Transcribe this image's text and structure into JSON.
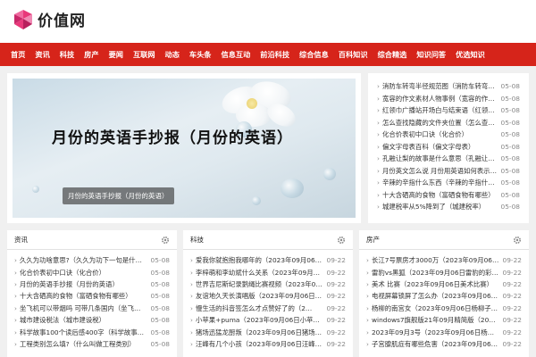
{
  "site": {
    "logo_text": "价值网"
  },
  "nav": [
    "首页",
    "资讯",
    "科技",
    "房产",
    "要闻",
    "互联网",
    "动态",
    "车头条",
    "信息互动",
    "前沿科技",
    "综合信息",
    "百科知识",
    "综合精选",
    "知识问答",
    "优选知识"
  ],
  "banner": {
    "title": "月份的英语手抄报（月份的英语）",
    "caption": "月份的英语手抄报（月份的英语）"
  },
  "top_list": [
    {
      "title": "消防车转弯半径规范图（消防车转弯半…",
      "date": "05-08"
    },
    {
      "title": "宽容的作文素材人物事例（宽容的作文）",
      "date": "05-08"
    },
    {
      "title": "红领巾广播站开场白与结束语（红领巾…",
      "date": "05-08"
    },
    {
      "title": "怎么查找隐藏的文件夹位置（怎么查找…",
      "date": "05-08"
    },
    {
      "title": "化合价表初中口诀（化合价）",
      "date": "05-08"
    },
    {
      "title": "偏文字母表百科（偏文字母表）",
      "date": "05-08"
    },
    {
      "title": "孔融让梨的故事是什么意思（孔融让梨…",
      "date": "05-08"
    },
    {
      "title": "月份英文怎么说 月份用英语如何表示…",
      "date": "05-08"
    },
    {
      "title": "辛辣的辛指什么东西（辛辣的辛指什么…",
      "date": "05-08"
    },
    {
      "title": "十大含硒高的食物（富硒食物有哪些）",
      "date": "05-08"
    },
    {
      "title": "城建税率从5%降到了（城建税率）",
      "date": "05-08"
    }
  ],
  "panels": [
    {
      "title": "资讯",
      "items": [
        {
          "title": "久久为功啥意思?（久久为功下一句是什…",
          "date": "05-08"
        },
        {
          "title": "化合价表初中口诀（化合价）",
          "date": "05-08"
        },
        {
          "title": "月份的英语手抄报（月份的英语）",
          "date": "05-08"
        },
        {
          "title": "十大含硒高的食物（富硒食物有哪些）",
          "date": "05-08"
        },
        {
          "title": "坐飞机可以带烟吗 可带几条国内（坐飞…",
          "date": "05-08"
        },
        {
          "title": "城市建设税法（城市建设税）",
          "date": "05-08"
        },
        {
          "title": "科学故事100个读后感400字（科学故事…",
          "date": "05-08"
        },
        {
          "title": "工程类别怎么填?（什么叫做工程类别）",
          "date": "05-08"
        }
      ]
    },
    {
      "title": "科技",
      "items": [
        {
          "title": "爱我你就抱抱我哪年的（2023年09月06…",
          "date": "09-22"
        },
        {
          "title": "李梓萌和李幼斌什么关系（2023年09月…",
          "date": "09-22"
        },
        {
          "title": "世界吉尼斯纪录鹅绳比赛视频（2023年0…",
          "date": "09-22"
        },
        {
          "title": "友谊地久天长演唱版（2023年09月06日…",
          "date": "09-22"
        },
        {
          "title": "慢生活的抖音签怎么才点赞好了的（2…",
          "date": "09-22"
        },
        {
          "title": "小苹果+puma（2023年09月06日小苹果…",
          "date": "09-22"
        },
        {
          "title": "猪场迅猛龙厨叛（2023年09月06日猪场…",
          "date": "09-22"
        },
        {
          "title": "汪峰有几个小孩（2023年09月06日汪峰…",
          "date": "09-22"
        }
      ]
    },
    {
      "title": "房产",
      "items": [
        {
          "title": "长江7号票房才3000万（2023年09月06…",
          "date": "09-22"
        },
        {
          "title": "雷豹vs黑狐（2023年09月06日雷豹的彩蛋…",
          "date": "09-22"
        },
        {
          "title": "美术 比赛（2023年09月06日美术比赛）",
          "date": "09-22"
        },
        {
          "title": "电视屏幕锁屏了怎么办（2023年09月06…",
          "date": "09-22"
        },
        {
          "title": "杨柳的南宫女（2023年09月06日杨柳子…",
          "date": "09-22"
        },
        {
          "title": "windows7旗舰版21年09月精简版（2023…",
          "date": "09-22"
        },
        {
          "title": "2023年09月3号（2023年09月06日杨柳…",
          "date": "09-22"
        },
        {
          "title": "子宫腺肌症有哪些危害（2023年09月06…",
          "date": "09-22"
        }
      ]
    }
  ],
  "colors": {
    "nav_red": "#d6241a",
    "accent_pink": "#e8387a"
  }
}
